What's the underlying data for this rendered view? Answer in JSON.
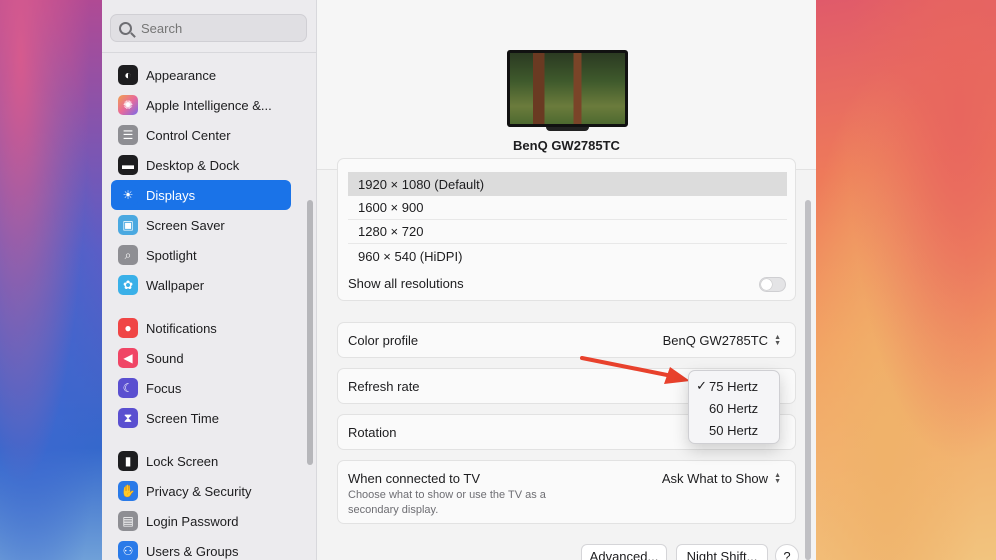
{
  "sidebar": {
    "search_placeholder": "Search",
    "items": [
      {
        "label": "Appearance",
        "icon": "appearance-icon",
        "color": "#1d1d1f"
      },
      {
        "label": "Apple Intelligence &...",
        "icon": "apple-intelligence-icon",
        "color": "#e86a9a"
      },
      {
        "label": "Control Center",
        "icon": "control-center-icon",
        "color": "#8e8e93"
      },
      {
        "label": "Desktop & Dock",
        "icon": "desktop-dock-icon",
        "color": "#1d1d1f"
      },
      {
        "label": "Displays",
        "icon": "displays-icon",
        "color": "#1a73e8"
      },
      {
        "label": "Screen Saver",
        "icon": "screen-saver-icon",
        "color": "#4aa8e0"
      },
      {
        "label": "Spotlight",
        "icon": "spotlight-icon",
        "color": "#8e8e93"
      },
      {
        "label": "Wallpaper",
        "icon": "wallpaper-icon",
        "color": "#3ab0e8"
      },
      {
        "label": "Notifications",
        "icon": "notifications-icon",
        "color": "#f04545"
      },
      {
        "label": "Sound",
        "icon": "sound-icon",
        "color": "#f04565"
      },
      {
        "label": "Focus",
        "icon": "focus-icon",
        "color": "#5a4fd0"
      },
      {
        "label": "Screen Time",
        "icon": "screen-time-icon",
        "color": "#5a4fd0"
      },
      {
        "label": "Lock Screen",
        "icon": "lock-screen-icon",
        "color": "#1d1d1f"
      },
      {
        "label": "Privacy & Security",
        "icon": "privacy-security-icon",
        "color": "#2a7ae8"
      },
      {
        "label": "Login Password",
        "icon": "login-password-icon",
        "color": "#8e8e93"
      },
      {
        "label": "Users & Groups",
        "icon": "users-groups-icon",
        "color": "#2a7ae8"
      }
    ]
  },
  "display": {
    "name": "BenQ GW2785TC",
    "resolutions": [
      "1920 × 1080 (Default)",
      "1600 × 900",
      "1280 × 720",
      "960 × 540 (HiDPI)"
    ],
    "show_all_label": "Show all resolutions",
    "color_profile_label": "Color profile",
    "color_profile_value": "BenQ GW2785TC",
    "refresh_rate_label": "Refresh rate",
    "rotation_label": "Rotation",
    "tv_label": "When connected to TV",
    "tv_value": "Ask What to Show",
    "tv_subtext": "Choose what to show or use the TV as a secondary display.",
    "advanced_label": "Advanced...",
    "night_shift_label": "Night Shift...",
    "help_label": "?"
  },
  "refresh_popup": {
    "options": [
      "75 Hertz",
      "60 Hertz",
      "50 Hertz"
    ],
    "selected": "75 Hertz",
    "checkmark": "✓"
  },
  "colors": {
    "accent": "#1a73e8",
    "annotation_arrow": "#e8412c"
  }
}
